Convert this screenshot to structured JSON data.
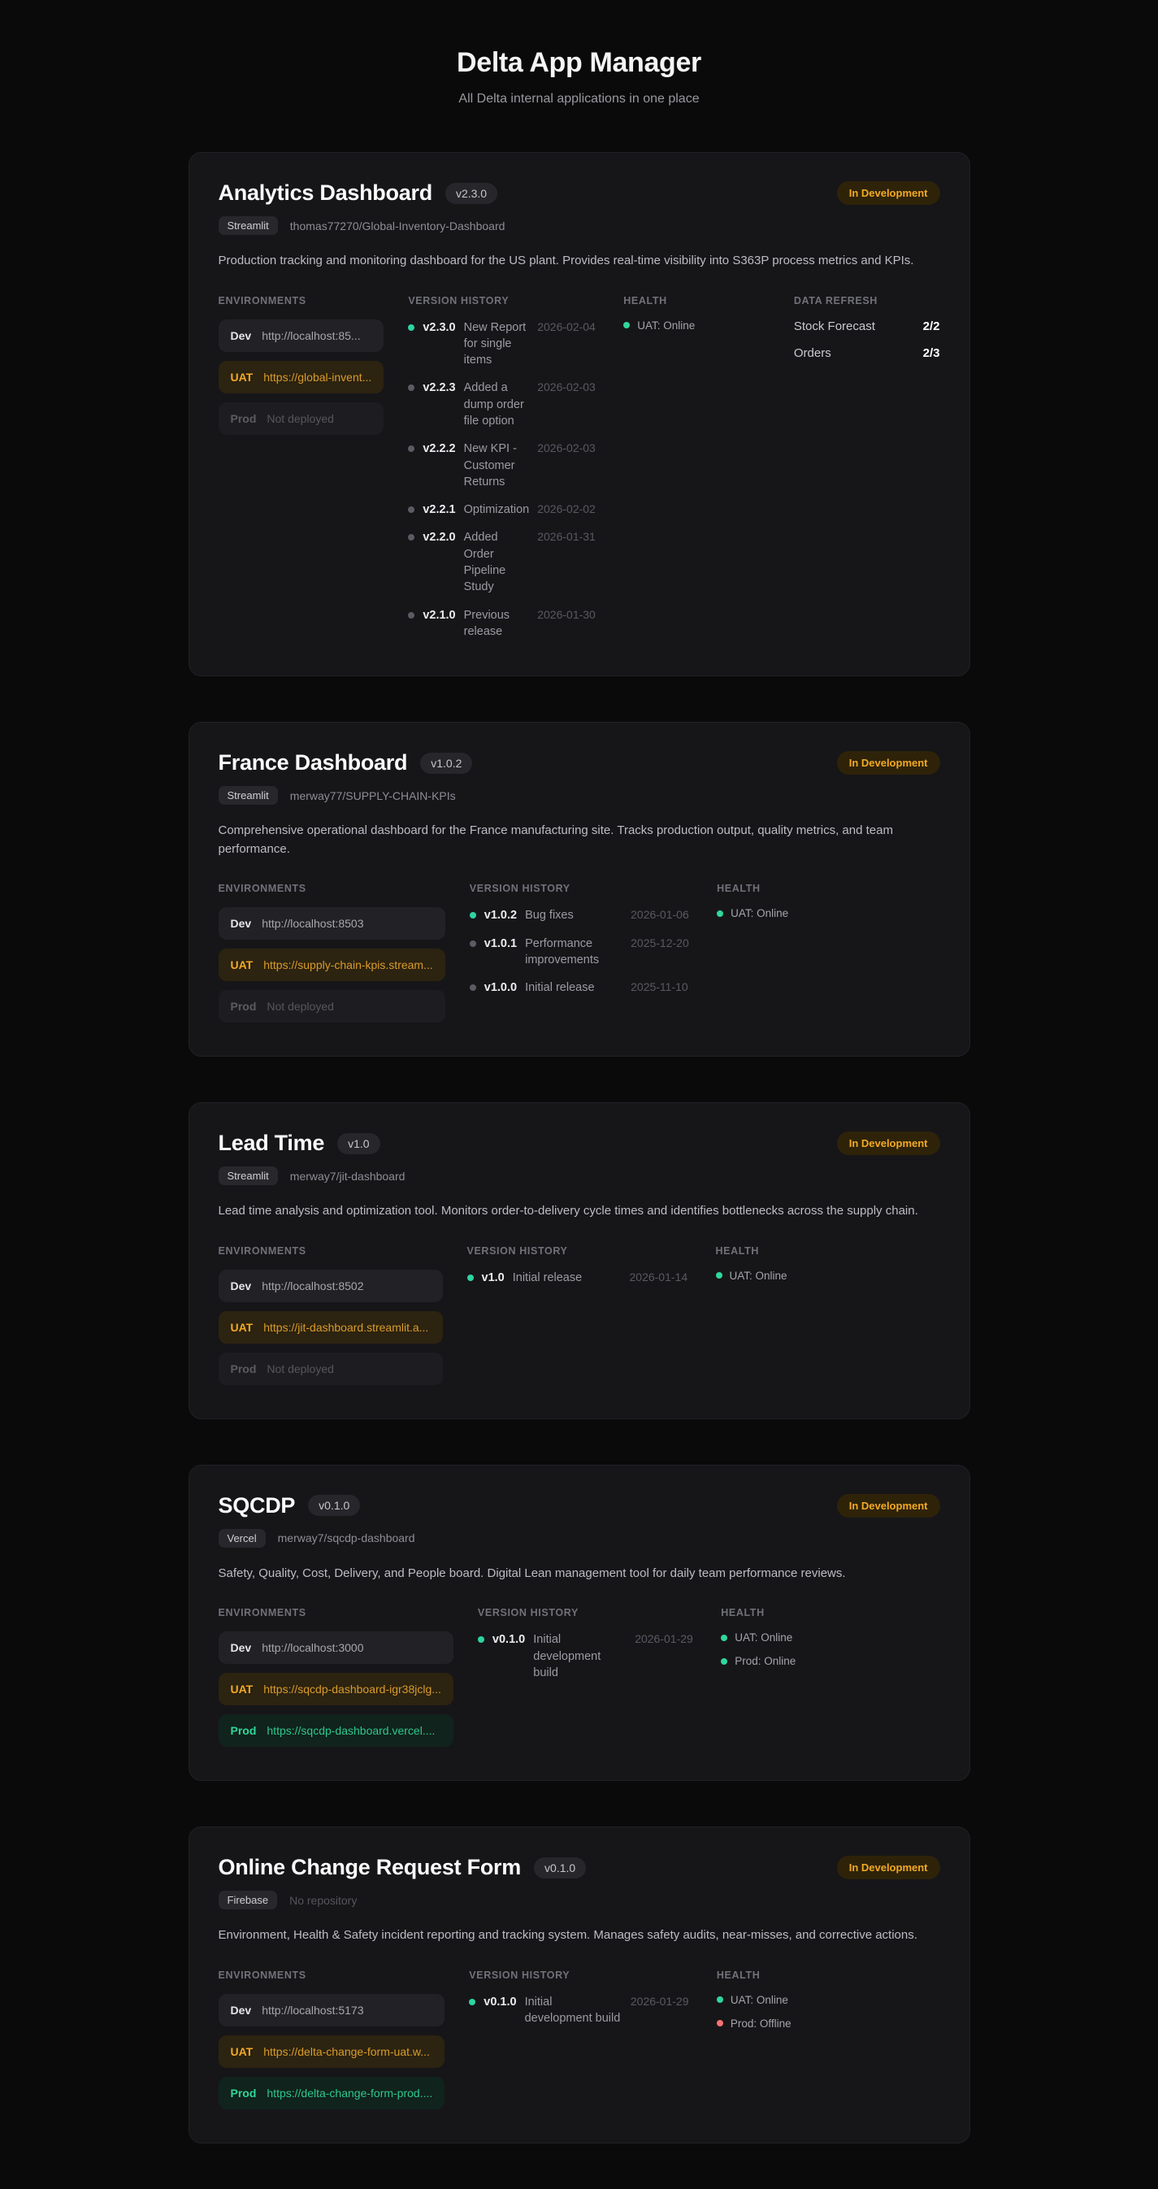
{
  "page": {
    "title": "Delta App Manager",
    "subtitle": "All Delta internal applications in one place"
  },
  "labels": {
    "environments": "ENVIRONMENTS",
    "version_history": "VERSION HISTORY",
    "health": "HEALTH",
    "data_refresh": "DATA REFRESH"
  },
  "colors": {
    "background": "#0a0a0b",
    "card_background": "#161619",
    "accent_amber": "#f3a924",
    "status_online_green": "#31d69a",
    "status_offline_red": "#f87171",
    "latest_version_teal": "#2dd4a0"
  },
  "apps": [
    {
      "name": "Analytics Dashboard",
      "version": "v2.3.0",
      "status": "In Development",
      "platform": "Streamlit",
      "repo": "thomas77270/Global-Inventory-Dashboard",
      "description": "Production tracking and monitoring dashboard for the US plant. Provides real-time visibility into S363P process metrics and KPIs.",
      "environments": [
        {
          "name": "Dev",
          "url": "http://localhost:85...",
          "state": "plain"
        },
        {
          "name": "UAT",
          "url": "https://global-invent...",
          "state": "uat"
        },
        {
          "name": "Prod",
          "url": "Not deployed",
          "state": "none"
        }
      ],
      "versions": [
        {
          "version": "v2.3.0",
          "note": "New Report for single items",
          "date": "2026-02-04",
          "marker": "latest"
        },
        {
          "version": "v2.2.3",
          "note": "Added a dump order file option",
          "date": "2026-02-03",
          "marker": "old"
        },
        {
          "version": "v2.2.2",
          "note": "New KPI - Customer Returns",
          "date": "2026-02-03",
          "marker": "old"
        },
        {
          "version": "v2.2.1",
          "note": "Optimization",
          "date": "2026-02-02",
          "marker": "old"
        },
        {
          "version": "v2.2.0",
          "note": "Added Order Pipeline Study",
          "date": "2026-01-31",
          "marker": "old"
        },
        {
          "version": "v2.1.0",
          "note": "Previous release",
          "date": "2026-01-30",
          "marker": "old"
        }
      ],
      "health": [
        {
          "label": "UAT: Online",
          "state": "online"
        }
      ],
      "data_refresh": [
        {
          "label": "Stock Forecast",
          "value": "2/2"
        },
        {
          "label": "Orders",
          "value": "2/3"
        }
      ]
    },
    {
      "name": "France Dashboard",
      "version": "v1.0.2",
      "status": "In Development",
      "platform": "Streamlit",
      "repo": "merway77/SUPPLY-CHAIN-KPIs",
      "description": "Comprehensive operational dashboard for the France manufacturing site. Tracks production output, quality metrics, and team performance.",
      "environments": [
        {
          "name": "Dev",
          "url": "http://localhost:8503",
          "state": "plain"
        },
        {
          "name": "UAT",
          "url": "https://supply-chain-kpis.stream...",
          "state": "uat"
        },
        {
          "name": "Prod",
          "url": "Not deployed",
          "state": "none"
        }
      ],
      "versions": [
        {
          "version": "v1.0.2",
          "note": "Bug fixes",
          "date": "2026-01-06",
          "marker": "latest"
        },
        {
          "version": "v1.0.1",
          "note": "Performance improvements",
          "date": "2025-12-20",
          "marker": "old"
        },
        {
          "version": "v1.0.0",
          "note": "Initial release",
          "date": "2025-11-10",
          "marker": "old"
        }
      ],
      "health": [
        {
          "label": "UAT: Online",
          "state": "online"
        }
      ]
    },
    {
      "name": "Lead Time",
      "version": "v1.0",
      "status": "In Development",
      "platform": "Streamlit",
      "repo": "merway7/jit-dashboard",
      "description": "Lead time analysis and optimization tool. Monitors order-to-delivery cycle times and identifies bottlenecks across the supply chain.",
      "environments": [
        {
          "name": "Dev",
          "url": "http://localhost:8502",
          "state": "plain"
        },
        {
          "name": "UAT",
          "url": "https://jit-dashboard.streamlit.a...",
          "state": "uat"
        },
        {
          "name": "Prod",
          "url": "Not deployed",
          "state": "none"
        }
      ],
      "versions": [
        {
          "version": "v1.0",
          "note": "Initial release",
          "date": "2026-01-14",
          "marker": "latest"
        }
      ],
      "health": [
        {
          "label": "UAT: Online",
          "state": "online"
        }
      ]
    },
    {
      "name": "SQCDP",
      "version": "v0.1.0",
      "status": "In Development",
      "platform": "Vercel",
      "repo": "merway7/sqcdp-dashboard",
      "description": "Safety, Quality, Cost, Delivery, and People board. Digital Lean management tool for daily team performance reviews.",
      "environments": [
        {
          "name": "Dev",
          "url": "http://localhost:3000",
          "state": "plain"
        },
        {
          "name": "UAT",
          "url": "https://sqcdp-dashboard-igr38jclg...",
          "state": "uat"
        },
        {
          "name": "Prod",
          "url": "https://sqcdp-dashboard.vercel....",
          "state": "prod"
        }
      ],
      "versions": [
        {
          "version": "v0.1.0",
          "note": "Initial development build",
          "date": "2026-01-29",
          "marker": "latest"
        }
      ],
      "health": [
        {
          "label": "UAT: Online",
          "state": "online"
        },
        {
          "label": "Prod: Online",
          "state": "online"
        }
      ]
    },
    {
      "name": "Online Change Request Form",
      "version": "v0.1.0",
      "status": "In Development",
      "platform": "Firebase",
      "repo": "No repository",
      "repo_state": "missing",
      "description": "Environment, Health & Safety incident reporting and tracking system. Manages safety audits, near-misses, and corrective actions.",
      "environments": [
        {
          "name": "Dev",
          "url": "http://localhost:5173",
          "state": "plain"
        },
        {
          "name": "UAT",
          "url": "https://delta-change-form-uat.w...",
          "state": "uat"
        },
        {
          "name": "Prod",
          "url": "https://delta-change-form-prod....",
          "state": "prod"
        }
      ],
      "versions": [
        {
          "version": "v0.1.0",
          "note": "Initial development build",
          "date": "2026-01-29",
          "marker": "latest"
        }
      ],
      "health": [
        {
          "label": "UAT: Online",
          "state": "online"
        },
        {
          "label": "Prod: Offline",
          "state": "offline"
        }
      ]
    }
  ]
}
